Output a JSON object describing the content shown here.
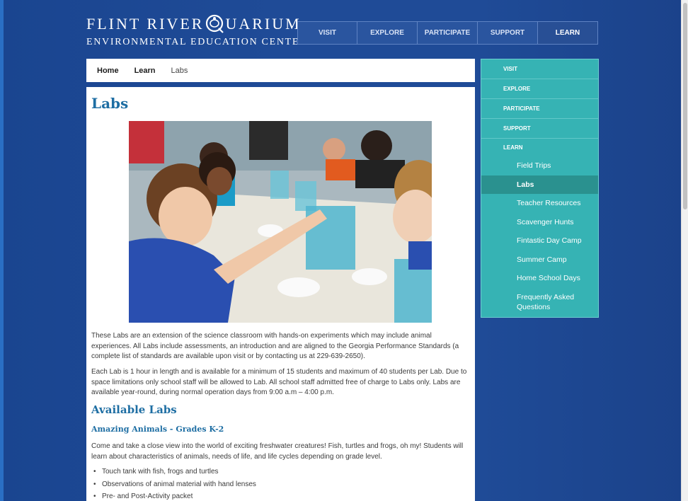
{
  "logo": {
    "line1_a": "Flint River",
    "line1_b": "uarium",
    "line2": "Environmental Education Center"
  },
  "topnav": [
    "Visit",
    "Explore",
    "Participate",
    "Support",
    "Learn"
  ],
  "breadcrumb": [
    "Home",
    "Learn",
    "Labs"
  ],
  "page": {
    "title": "Labs",
    "para1": "These Labs are an extension of the science classroom with hands-on experiments which may include animal experiences. All Labs include assessments, an introduction and are aligned to the Georgia Performance Standards (a complete list of standards are available upon visit or by contacting us at 229-639-2650).",
    "para2": "Each Lab is 1 hour in length and is available for a minimum of 15 students and maximum of 40 students per Lab. Due to space limitations only school staff will be allowed to Lab. All school staff admitted free of charge to Labs only.  Labs are available year-round, during normal operation days from 9:00 a.m – 4:00 p.m.",
    "available_heading": "Available Labs",
    "lab1_heading": "Amazing Animals - Grades K-2",
    "lab1_desc": "Come and take a close view into the world of exciting freshwater creatures! Fish, turtles and frogs, oh my! Students will learn about characteristics of animals, needs of life, and life cycles depending on grade level.",
    "lab1_bullets": [
      "Touch tank with fish, frogs and turtles",
      "Observations of animal material with hand lenses",
      "Pre- and Post-Activity packet"
    ]
  },
  "sidenav": {
    "top": [
      "Visit",
      "Explore",
      "Participate",
      "Support",
      "Learn"
    ],
    "sub": [
      "Field Trips",
      "Labs",
      "Teacher Resources",
      "Scavenger Hunts",
      "Fintastic Day Camp",
      "Summer Camp",
      "Home School Days",
      "Frequently Asked Questions"
    ],
    "active": "Labs"
  },
  "colors": {
    "background": "#1f4b97",
    "sidenav": "#36b3b4",
    "sidenav_active": "#2a918f",
    "heading": "#1e6ea3"
  }
}
